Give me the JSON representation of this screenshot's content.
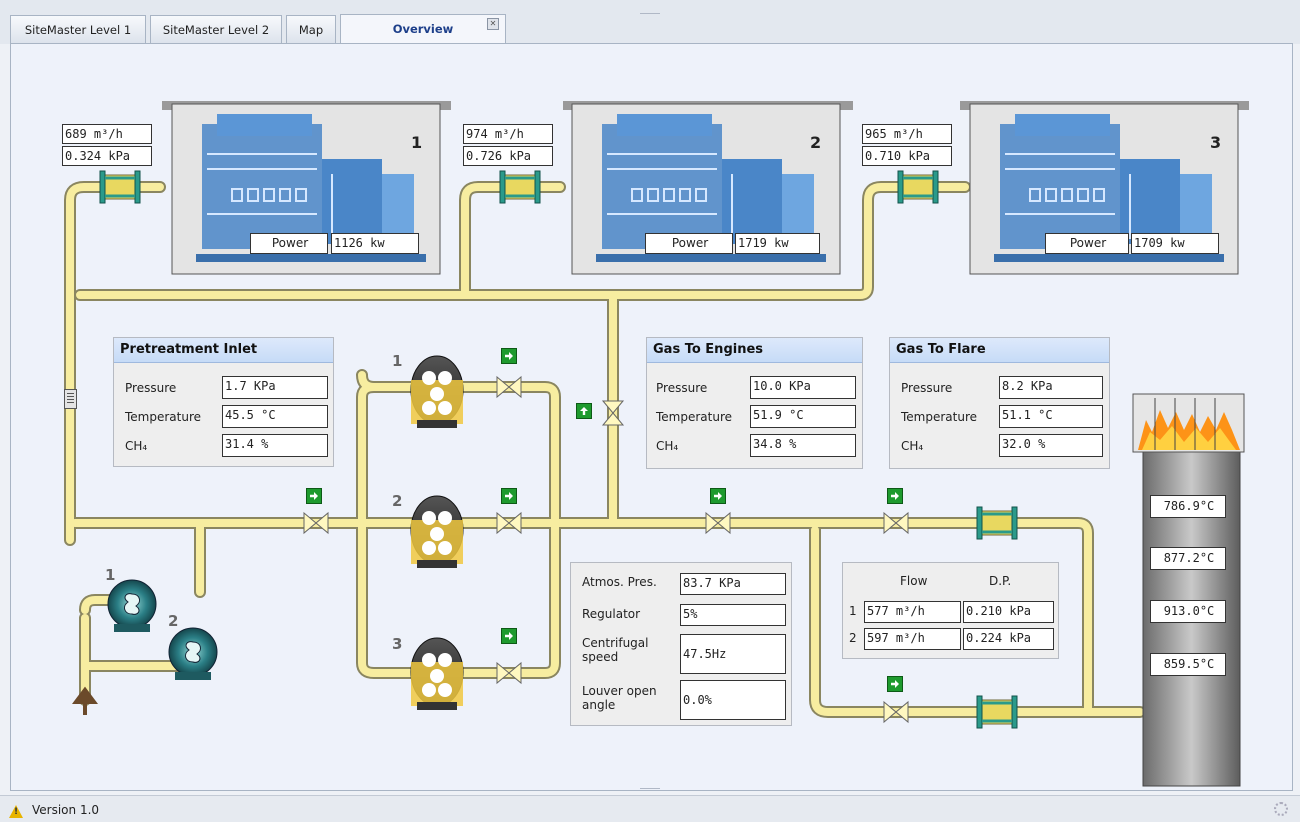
{
  "tabs": [
    {
      "label": "SiteMaster Level 1"
    },
    {
      "label": "SiteMaster Level 2"
    },
    {
      "label": "Map"
    },
    {
      "label": "Overview",
      "active": true
    }
  ],
  "tab_close_glyph": "✕",
  "engines": [
    {
      "number": "1",
      "flow": "689 m³/h",
      "pressure": "0.324 kPa",
      "power_label": "Power",
      "power": "1126 kw"
    },
    {
      "number": "2",
      "flow": "974 m³/h",
      "pressure": "0.726 kPa",
      "power_label": "Power",
      "power": "1719 kw"
    },
    {
      "number": "3",
      "flow": "965 m³/h",
      "pressure": "0.710 kPa",
      "power_label": "Power",
      "power": "1709 kw"
    }
  ],
  "pretreatment": {
    "title": "Pretreatment Inlet",
    "rows": [
      {
        "label": "Pressure",
        "value": "1.7 KPa"
      },
      {
        "label": "Temperature",
        "value": "45.5 °C"
      },
      {
        "label": "CH₄",
        "value": "31.4 %"
      }
    ]
  },
  "gas_to_engines": {
    "title": "Gas To Engines",
    "rows": [
      {
        "label": "Pressure",
        "value": "10.0 KPa"
      },
      {
        "label": "Temperature",
        "value": "51.9 °C"
      },
      {
        "label": "CH₄",
        "value": "34.8 %"
      }
    ]
  },
  "gas_to_flare": {
    "title": "Gas To Flare",
    "rows": [
      {
        "label": "Pressure",
        "value": "8.2 KPa"
      },
      {
        "label": "Temperature",
        "value": "51.1 °C"
      },
      {
        "label": "CH₄",
        "value": "32.0 %"
      }
    ]
  },
  "atmos": {
    "rows": [
      {
        "label": "Atmos. Pres.",
        "value": "83.7 KPa"
      },
      {
        "label": "Regulator",
        "value": "5%"
      },
      {
        "label": "Centrifugal speed",
        "value": "47.5Hz"
      },
      {
        "label": "Louver open angle",
        "value": "0.0%"
      }
    ]
  },
  "flow_table": {
    "col_flow": "Flow",
    "col_dp": "D.P.",
    "rows": [
      {
        "index": "1",
        "flow": "577 m³/h",
        "dp": "0.210 kPa"
      },
      {
        "index": "2",
        "flow": "597 m³/h",
        "dp": "0.224 kPa"
      }
    ]
  },
  "flare_temps": [
    "786.9°C",
    "877.2°C",
    "913.0°C",
    "859.5°C"
  ],
  "blowers": [
    {
      "number": "1"
    },
    {
      "number": "2"
    }
  ],
  "pumps": [
    {
      "number": "1"
    },
    {
      "number": "2"
    },
    {
      "number": "3"
    }
  ],
  "status": {
    "version": "Version 1.0"
  },
  "colors": {
    "pipe": "#f7eda0",
    "pipe_border": "#8a8660",
    "engine": "#4a86c8",
    "valve": "#2a9a8a",
    "flange": "#e8d860",
    "flame": "#ff8a00",
    "arrow_button": "#1e9a2e"
  }
}
